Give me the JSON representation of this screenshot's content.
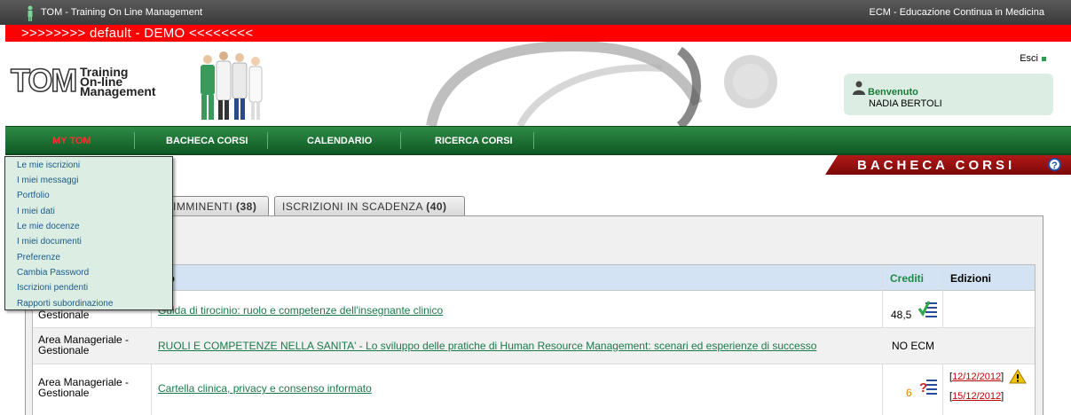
{
  "topbar": {
    "app_title": "TOM - Training On Line Management",
    "right_title": "ECM - Educazione Continua in Medicina"
  },
  "env_banner": ">>>>>>>> default - DEMO <<<<<<<<",
  "header": {
    "logo_main": "TOM",
    "logo_line1": "Training",
    "logo_line2": "On-line",
    "logo_line3": "Management",
    "logout_label": "Esci",
    "welcome_label": "Benvenuto",
    "user_name": "NADIA BERTOLI"
  },
  "nav": {
    "items": [
      {
        "label": "MY TOM"
      },
      {
        "label": "BACHECA CORSI"
      },
      {
        "label": "CALENDARIO"
      },
      {
        "label": "RICERCA CORSI"
      }
    ]
  },
  "page_title": "BACHECA CORSI",
  "help_icon": "?",
  "tabs": [
    {
      "label": "IMMINENTI",
      "count": "(38)"
    },
    {
      "label": "ISCRIZIONI IN SCADENZA",
      "count": "(40)"
    }
  ],
  "table": {
    "headers": {
      "title": "olo",
      "credits": "Crediti",
      "editions": "Edizioni"
    },
    "rows": [
      {
        "area_line2": "Gestionale",
        "title": "Guida di tirocinio: ruolo e competenze dell'insegnante clinico",
        "credits": "48,5",
        "credit_icon": "check-list-icon",
        "editions": []
      },
      {
        "area_line1": "Area Manageriale -",
        "area_line2": "Gestionale",
        "title": "RUOLI E COMPETENZE NELLA SANITA' - Lo sviluppo delle pratiche di Human Resource Management: scenari ed esperienze di successo",
        "credits": "NO ECM",
        "editions": []
      },
      {
        "area_line1": "Area Manageriale -",
        "area_line2": "Gestionale",
        "title": "Cartella clinica, privacy e consenso informato",
        "credits": "6",
        "credit_icon": "question-list-icon",
        "editions": [
          "12/12/2012",
          "15/12/2012"
        ]
      }
    ]
  },
  "dropdown_menu": [
    "Le mie iscrizioni",
    "I miei messaggi",
    "Portfolio",
    "I miei dati",
    "Le mie docenze",
    "I miei documenti",
    "Preferenze",
    "Cambia Password",
    "Iscrizioni pendenti",
    "Rapporti subordinazione"
  ],
  "colors": {
    "nav_green": "#1a7a3a",
    "banner_red": "#ff0000",
    "title_banner": "#9a1010",
    "link_green": "#1a7a4a",
    "date_red": "#c00000"
  }
}
